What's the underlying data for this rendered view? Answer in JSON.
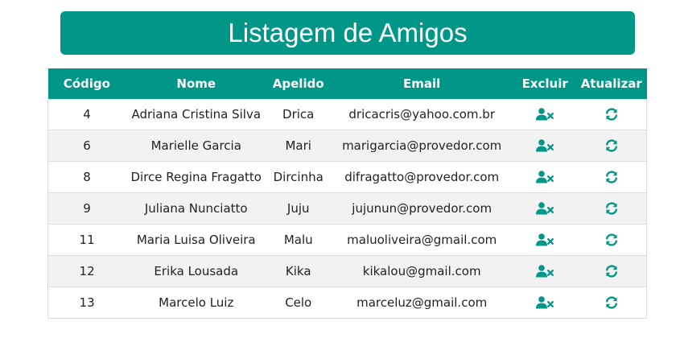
{
  "page": {
    "title": "Listagem de Amigos"
  },
  "table": {
    "headers": {
      "codigo": "Código",
      "nome": "Nome",
      "apelido": "Apelido",
      "email": "Email",
      "excluir": "Excluir",
      "atualizar": "Atualizar"
    },
    "rows": [
      {
        "codigo": "4",
        "nome": "Adriana Cristina Silva",
        "apelido": "Drica",
        "email": "dricacris@yahoo.com.br"
      },
      {
        "codigo": "6",
        "nome": "Marielle Garcia",
        "apelido": "Mari",
        "email": "marigarcia@provedor.com"
      },
      {
        "codigo": "8",
        "nome": "Dirce Regina Fragatto",
        "apelido": "Dircinha",
        "email": "difragatto@provedor.com"
      },
      {
        "codigo": "9",
        "nome": "Juliana Nunciatto",
        "apelido": "Juju",
        "email": "jujunun@provedor.com"
      },
      {
        "codigo": "11",
        "nome": "Maria Luisa Oliveira",
        "apelido": "Malu",
        "email": "maluoliveira@gmail.com"
      },
      {
        "codigo": "12",
        "nome": "Erika Lousada",
        "apelido": "Kika",
        "email": "kikalou@gmail.com"
      },
      {
        "codigo": "13",
        "nome": "Marcelo Luiz",
        "apelido": "Celo",
        "email": "marceluz@gmail.com"
      }
    ],
    "icons": {
      "delete": "user-times-icon",
      "update": "refresh-icon"
    }
  },
  "colors": {
    "accent": "#009688",
    "header_text": "#ffffff",
    "stripe": "#f2f2f2"
  }
}
